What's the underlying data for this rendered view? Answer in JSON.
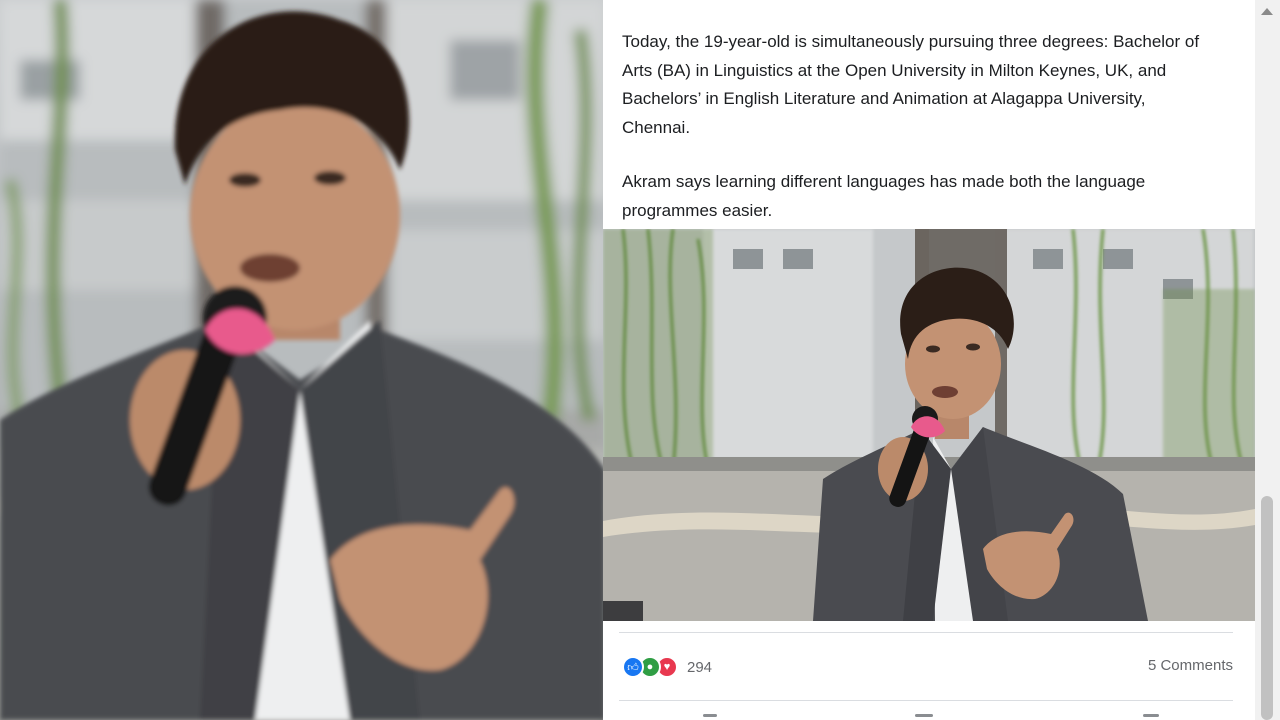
{
  "post": {
    "paragraphs": [
      "Today, the 19-year-old is simultaneously pursuing three degrees: Bachelor of Arts (BA) in Linguistics at the Open University in Milton Keynes, UK, and Bachelors’ in English Literature and Animation at Alagappa University, Chennai.",
      "Akram says learning different languages has made both the language programmes easier."
    ],
    "image_alt": "Young man in a grey blazer speaking into a microphone with a pink windscreen",
    "reactions": {
      "icons": [
        "like-icon",
        "care-icon",
        "love-icon"
      ],
      "count": "294"
    },
    "comments_label": "5 Comments"
  },
  "colors": {
    "text": "#1c1e21",
    "muted": "#65676b",
    "like": "#1877f2",
    "care": "#2f9e44",
    "love": "#e8384f"
  }
}
